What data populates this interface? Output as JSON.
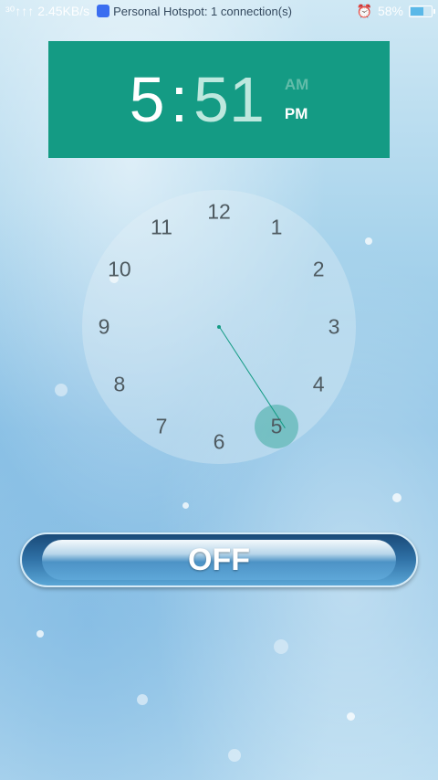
{
  "status_bar": {
    "signal": "³⁰↑↑↑",
    "network_speed": "2.45KB/s",
    "hotspot_text": "Personal Hotspot: 1 connection(s)",
    "battery_percent": "58%",
    "battery_level": 0.58
  },
  "time_display": {
    "hour": "5",
    "separator": ":",
    "minute": "51",
    "am_label": "AM",
    "pm_label": "PM",
    "selected_period": "PM"
  },
  "dial": {
    "numbers": [
      "12",
      "1",
      "2",
      "3",
      "4",
      "5",
      "6",
      "7",
      "8",
      "9",
      "10",
      "11"
    ],
    "selected_value": "5"
  },
  "off_button": {
    "label": "OFF"
  },
  "colors": {
    "accent": "#149b84",
    "accent_light": "#bde8de"
  }
}
